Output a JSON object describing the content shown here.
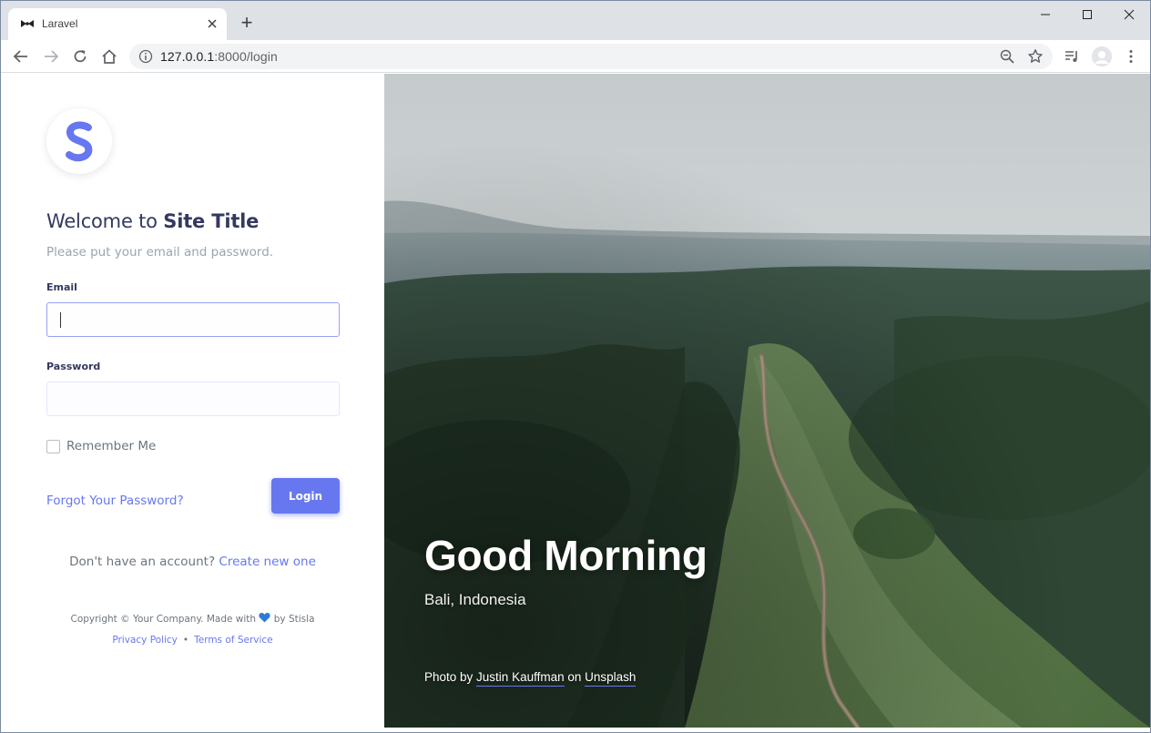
{
  "browser": {
    "tab_title": "Laravel",
    "new_tab_symbol": "+",
    "url_host": "127.0.0.1",
    "url_path": ":8000/login"
  },
  "login": {
    "welcome_prefix": "Welcome to ",
    "site_title": "Site Title",
    "subtitle": "Please put your email and password.",
    "email_label": "Email",
    "email_value": "",
    "password_label": "Password",
    "password_value": "",
    "remember_label": "Remember Me",
    "forgot_link": "Forgot Your Password?",
    "login_button": "Login",
    "signup_prompt": "Don't have an account? ",
    "signup_link": "Create new one",
    "copyright_prefix": "Copyright © Your Company. Made with ",
    "copyright_suffix": " by Stisla",
    "privacy_link": "Privacy Policy",
    "separator": "•",
    "terms_link": "Terms of Service"
  },
  "hero": {
    "greeting": "Good Morning",
    "location": "Bali, Indonesia",
    "credit_prefix": "Photo by ",
    "photographer": "Justin Kauffman",
    "credit_middle": " on ",
    "source": "Unsplash"
  },
  "colors": {
    "primary": "#6777ef",
    "heading": "#34395e",
    "muted": "#98a6ad"
  }
}
